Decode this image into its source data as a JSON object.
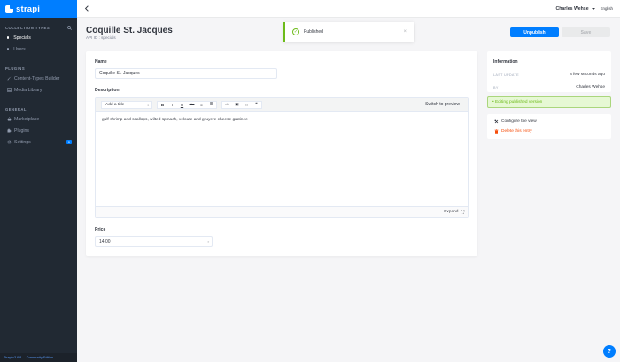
{
  "brand": {
    "name": "strapi"
  },
  "sidebar": {
    "collection_heading": "Collection Types",
    "collection_items": [
      "Specials",
      "Users"
    ],
    "plugins_heading": "Plugins",
    "plugin_items": [
      "Content-Types Builder",
      "Media Library"
    ],
    "general_heading": "General",
    "general_items": [
      "Marketplace",
      "Plugins",
      "Settings"
    ],
    "settings_badge": "0",
    "footer_version": "Strapi v3.6.8",
    "footer_edition": "— Community Edition"
  },
  "topbar": {
    "user_name": "Charles Wehse",
    "language": "English"
  },
  "notification": {
    "text": "Published",
    "close": "×"
  },
  "header": {
    "title": "Coquille St. Jacques",
    "api_id": "API ID : specials",
    "unpublish_label": "Unpublish",
    "save_label": "Save"
  },
  "form": {
    "name_label": "Name",
    "name_value": "Coquille St. Jacques",
    "description_label": "Description",
    "title_select": "Add a title",
    "toolbar_buttons": [
      "B",
      "I",
      "U",
      "abc",
      "≡",
      "≣",
      "</>",
      "▣",
      "⇔",
      "❝"
    ],
    "switch_preview": "Switch to preview",
    "description_value": "gulf shrimp and scallops, wilted spinach, veloute and gruyere cheese gratinee",
    "expand_label": "Expand",
    "price_label": "Price",
    "price_value": "14.00"
  },
  "info": {
    "title": "Information",
    "last_update_key": "Last update",
    "last_update_val": "a few seconds ago",
    "by_key": "By",
    "by_val": "Charles Wehse"
  },
  "editing_notice": "• Editing published version",
  "actions": {
    "configure": "Configure the view",
    "delete": "Delete this entry"
  },
  "help": {
    "label": "?"
  },
  "colors": {
    "accent": "#007eff",
    "sidebar": "#212933",
    "success": "#6dbb1a",
    "danger": "#f64d0a"
  }
}
